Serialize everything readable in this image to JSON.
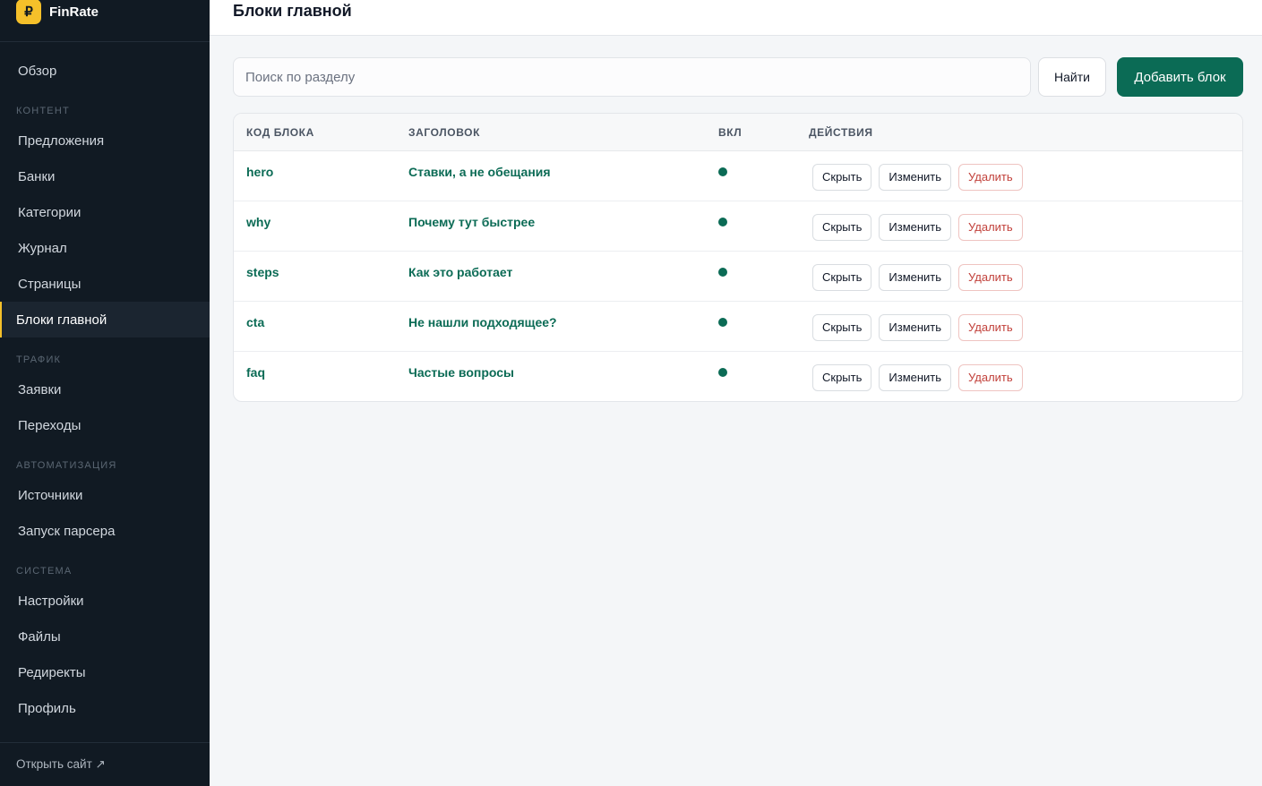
{
  "brand": {
    "logo_symbol": "₽",
    "name": "FinRate"
  },
  "sidebar": {
    "items": [
      {
        "type": "item",
        "label": "Обзор"
      },
      {
        "type": "section",
        "label": "КОНТЕНТ"
      },
      {
        "type": "item",
        "label": "Предложения"
      },
      {
        "type": "item",
        "label": "Банки"
      },
      {
        "type": "item",
        "label": "Категории"
      },
      {
        "type": "item",
        "label": "Журнал"
      },
      {
        "type": "item",
        "label": "Страницы"
      },
      {
        "type": "item",
        "label": "Блоки главной",
        "active": true
      },
      {
        "type": "section",
        "label": "ТРАФИК"
      },
      {
        "type": "item",
        "label": "Заявки"
      },
      {
        "type": "item",
        "label": "Переходы"
      },
      {
        "type": "section",
        "label": "АВТОМАТИЗАЦИЯ"
      },
      {
        "type": "item",
        "label": "Источники"
      },
      {
        "type": "item",
        "label": "Запуск парсера"
      },
      {
        "type": "section",
        "label": "СИСТЕМА"
      },
      {
        "type": "item",
        "label": "Настройки"
      },
      {
        "type": "item",
        "label": "Файлы"
      },
      {
        "type": "item",
        "label": "Редиректы"
      },
      {
        "type": "item",
        "label": "Профиль"
      }
    ],
    "footer_link": "Открыть сайт ↗"
  },
  "header": {
    "title": "Блоки главной"
  },
  "search": {
    "placeholder": "Поиск по разделу",
    "value": "",
    "find_label": "Найти"
  },
  "add_button_label": "Добавить блок",
  "table": {
    "headers": {
      "code": "КОД БЛОКА",
      "title": "ЗАГОЛОВОК",
      "enabled": "ВКЛ",
      "actions": "ДЕЙСТВИЯ"
    },
    "action_labels": {
      "hide": "Скрыть",
      "edit": "Изменить",
      "delete": "Удалить"
    },
    "rows": [
      {
        "code": "hero",
        "title": "Ставки, а не обещания",
        "enabled": true
      },
      {
        "code": "why",
        "title": "Почему тут быстрее",
        "enabled": true
      },
      {
        "code": "steps",
        "title": "Как это работает",
        "enabled": true
      },
      {
        "code": "cta",
        "title": "Не нашли подходящее?",
        "enabled": true
      },
      {
        "code": "faq",
        "title": "Частые вопросы",
        "enabled": true
      }
    ]
  },
  "colors": {
    "accent": "#0b6b55",
    "brand_logo": "#f5c02a",
    "sidebar_bg": "#111a23",
    "danger": "#c2413b"
  }
}
